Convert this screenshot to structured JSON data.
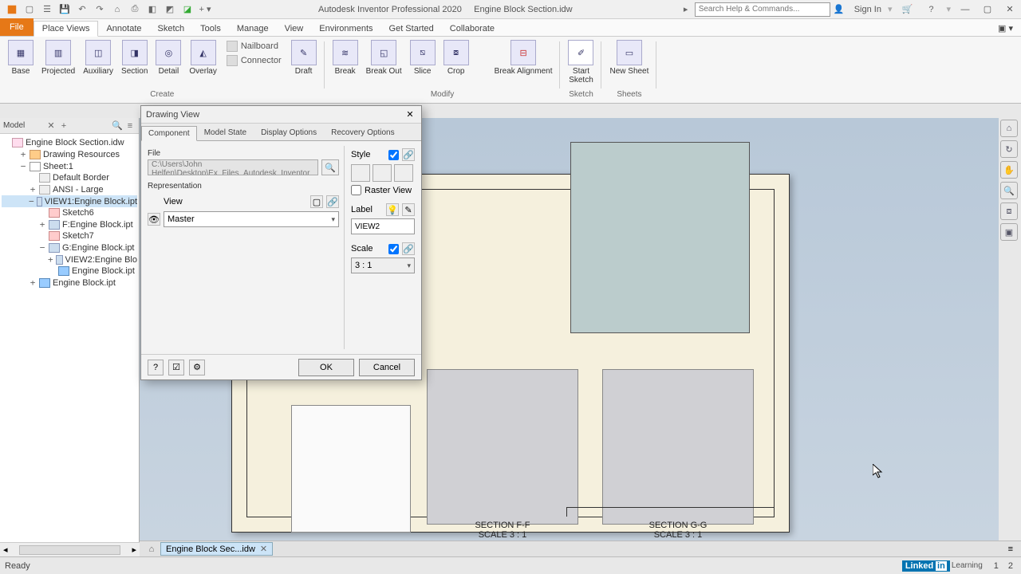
{
  "titlebar": {
    "app_title": "Autodesk Inventor Professional 2020",
    "doc_title": "Engine Block Section.idw",
    "search_placeholder": "Search Help & Commands...",
    "signin": "Sign In"
  },
  "ribbon_tabs": {
    "file": "File",
    "place_views": "Place Views",
    "annotate": "Annotate",
    "sketch": "Sketch",
    "tools": "Tools",
    "manage": "Manage",
    "view": "View",
    "environments": "Environments",
    "get_started": "Get Started",
    "collaborate": "Collaborate"
  },
  "ribbon": {
    "create": {
      "base": "Base",
      "projected": "Projected",
      "auxiliary": "Auxiliary",
      "section": "Section",
      "detail": "Detail",
      "overlay": "Overlay",
      "nailboard": "Nailboard",
      "connector": "Connector",
      "draft": "Draft",
      "group": "Create"
    },
    "modify": {
      "break": "Break",
      "breakout": "Break Out",
      "slice": "Slice",
      "crop": "Crop",
      "break_alignment": "Break Alignment",
      "group": "Modify"
    },
    "sketch": {
      "start_sketch": "Start\nSketch",
      "group": "Sketch"
    },
    "sheets": {
      "new_sheet": "New Sheet",
      "group": "Sheets"
    }
  },
  "browser": {
    "title": "Model",
    "root": "Engine Block Section.idw",
    "drawing_resources": "Drawing Resources",
    "sheet": "Sheet:1",
    "default_border": "Default Border",
    "ansi_large": "ANSI - Large",
    "view1": "VIEW1:Engine Block.ipt",
    "sketch6": "Sketch6",
    "f_section": "F:Engine Block.ipt",
    "sketch7": "Sketch7",
    "g_section": "G:Engine Block.ipt",
    "view2": "VIEW2:Engine Blo",
    "engine_block_ipt": "Engine Block.ipt",
    "engine_block_ipt2": "Engine Block.ipt"
  },
  "dialog": {
    "title": "Drawing View",
    "tabs": {
      "component": "Component",
      "model_state": "Model State",
      "display_options": "Display Options",
      "recovery": "Recovery Options"
    },
    "file_label": "File",
    "file_path": "C:\\Users\\John Helfen\\Desktop\\Ex_Files_Autodesk_Inventor_",
    "representation_label": "Representation",
    "view_label": "View",
    "view_value": "Master",
    "style_label": "Style",
    "raster_view": "Raster View",
    "label_label": "Label",
    "label_value": "VIEW2",
    "scale_label": "Scale",
    "scale_value": "3 : 1",
    "ok": "OK",
    "cancel": "Cancel"
  },
  "canvas": {
    "section_f_title": "SECTION F-F",
    "section_f_scale": "SCALE 3 : 1",
    "section_g_title": "SECTION G-G",
    "section_g_scale": "SCALE 3 : 1"
  },
  "doctab": {
    "label": "Engine Block Sec...idw"
  },
  "status": {
    "ready": "Ready",
    "page1": "1",
    "page2": "2",
    "linkedin": "Linked",
    "in": "in",
    "learning": "Learning"
  }
}
